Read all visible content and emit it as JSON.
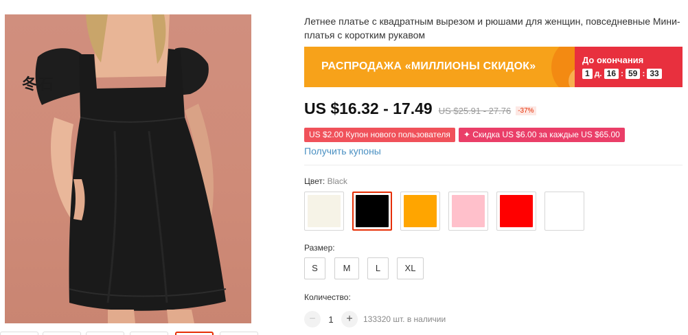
{
  "product": {
    "title": "Летнее платье с квадратным вырезом и рюшами для женщин, повседневные Мини-платья с коротким рукавом",
    "image_watermark": "冬石"
  },
  "promo": {
    "banner_text": "РАСПРОДАЖА «МИЛЛИОНЫ СКИДОК»",
    "countdown_label": "До окончания",
    "countdown": {
      "days": "1",
      "days_unit": "д.",
      "hours": "16",
      "minutes": "59",
      "seconds": "33",
      "separator": ":"
    },
    "colors": {
      "banner": "#f7a21a",
      "countdown_bg": "#e8303e"
    }
  },
  "price": {
    "current": "US $16.32 - 17.49",
    "original": "US $25.91 - 27.76",
    "discount": "-37%"
  },
  "coupons": {
    "new_user": "US $2.00 Купон нового пользователя",
    "store": "✦ Скидка US $6.00 за каждые US $65.00",
    "get_link": "Получить купоны"
  },
  "color_selector": {
    "label": "Цвет:",
    "selected_name": "Black",
    "options": [
      {
        "name": "cream",
        "hex": "#f6f3e7"
      },
      {
        "name": "black",
        "hex": "#000000",
        "selected": true
      },
      {
        "name": "orange",
        "hex": "#ffa500"
      },
      {
        "name": "pink",
        "hex": "#ffc0cb"
      },
      {
        "name": "red",
        "hex": "#ff0000"
      },
      {
        "name": "white",
        "hex": "#ffffff"
      }
    ]
  },
  "size_selector": {
    "label": "Размер:",
    "options": [
      "S",
      "M",
      "L",
      "XL"
    ]
  },
  "quantity": {
    "label": "Количество:",
    "minus": "−",
    "plus": "+",
    "value": "1",
    "stock": "133320 шт. в наличии"
  },
  "accent_color": "#e62e04"
}
